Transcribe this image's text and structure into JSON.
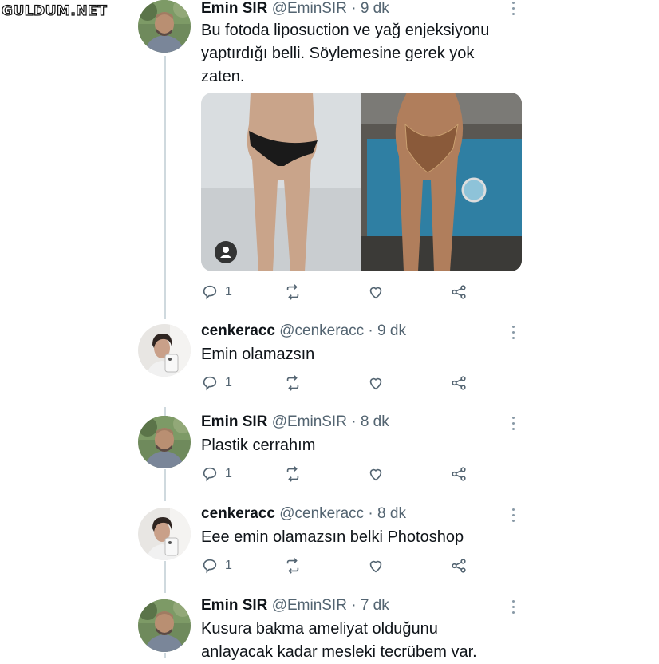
{
  "watermark": "GULDUM.NET",
  "colors": {
    "name": "#0f1419",
    "meta": "#536471",
    "thread_line": "#cfd9de",
    "icon": "#536471"
  },
  "tweets": [
    {
      "name": "Emin SIR",
      "handle": "@EminSIR",
      "sep": "·",
      "time": "9 dk",
      "text_lines": [
        "Bu fotoda liposuction ve yağ enjeksiyonu",
        "yaptırdığı belli. Söylemesine gerek yok",
        "zaten."
      ],
      "reply_count": "1",
      "has_media": true
    },
    {
      "name": "cenkeracc",
      "handle": "@cenkeracc",
      "sep": "·",
      "time": "9 dk",
      "text_lines": [
        "Emin olamazsın"
      ],
      "reply_count": "1"
    },
    {
      "name": "Emin SIR",
      "handle": "@EminSIR",
      "sep": "·",
      "time": "8 dk",
      "text_lines": [
        "Plastik cerrahım"
      ],
      "reply_count": "1"
    },
    {
      "name": "cenkeracc",
      "handle": "@cenkeracc",
      "sep": "·",
      "time": "8 dk",
      "text_lines": [
        "Eee emin olamazsın belki Photoshop"
      ],
      "reply_count": "1"
    },
    {
      "name": "Emin SIR",
      "handle": "@EminSIR",
      "sep": "·",
      "time": "7 dk",
      "text_lines": [
        "Kusura bakma ameliyat olduğunu",
        "anlayacak kadar mesleki tecrübem var."
      ]
    }
  ],
  "icons": {
    "reply": "reply-icon",
    "retweet": "retweet-icon",
    "like": "heart-icon",
    "share": "share-icon",
    "more": "more-options-icon",
    "media_user": "user-tag-icon"
  }
}
